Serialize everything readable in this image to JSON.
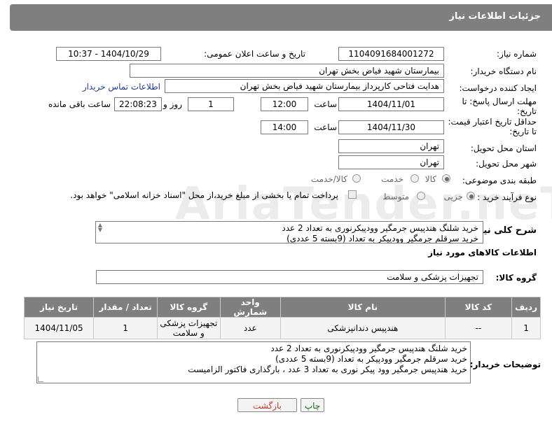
{
  "header": {
    "title": "جزئیات اطلاعات نیاز"
  },
  "fields": {
    "need_number_label": "شماره نیاز:",
    "need_number": "1104091684001272",
    "announce_label": "تاریخ و ساعت اعلان عمومی:",
    "announce_value": "1404/10/29 - 10:37",
    "buyer_org_label": "نام دستگاه خریدار:",
    "buyer_org": "بیمارستان شهید فیاض بخش تهران",
    "requester_label": "ایجاد کننده درخواست:",
    "requester": "هدایت فتاحی کارپرداز بیمارستان شهید فیاض بخش تهران",
    "contact_link": "اطلاعات تماس خریدار",
    "deadline_label_1": "مهلت ارسال پاسخ: تا",
    "deadline_label_2": "تاریخ:",
    "deadline_date": "1404/11/01",
    "time_label": "ساعت",
    "deadline_time": "12:00",
    "days_value": "1",
    "days_label": "روز و",
    "remaining_time": "22:08:23",
    "remaining_label": "ساعت باقی مانده",
    "min_price_label_1": "حداقل تاریخ اعتبار قیمت:",
    "min_price_label_2": "تا تاریخ:",
    "min_price_date": "1404/11/30",
    "min_price_time": "14:00",
    "province_label": "استان محل تحویل:",
    "province": "تهران",
    "city_label": "شهر محل تحویل:",
    "city": "تهران",
    "category_label": "طبقه بندی موضوعی:",
    "category_options": [
      "کالا",
      "خدمت",
      "کالا/خدمت"
    ],
    "process_label": "نوع فرآیند خرید :",
    "process_options": [
      "جزیی",
      "متوسط"
    ],
    "payment_note": "پرداخت تمام یا بخشی از مبلغ خرید،از محل \"اسناد خزانه اسلامی\" خواهد بود.",
    "description_label": "شرح کلی نیاز:",
    "description": "خرید شلنگ هندپیس جرمگیر وودپیکرنوری به تعداد 2 عدد\nخرید سرقلم جرمگیر وودپیکر به تعداد (9بسته 5 عددی)",
    "goods_info_title": "اطلاعات کالاهای مورد نیاز",
    "goods_group_label": "گروه کالا:",
    "goods_group": "تجهیزات پزشکی و سلامت"
  },
  "table": {
    "headers": [
      "ردیف",
      "کد کالا",
      "نام کالا",
      "واحد شمارش",
      "گروه کالا",
      "تعداد / مقدار",
      "تاریخ نیاز"
    ],
    "rows": [
      [
        "1",
        "--",
        "هندپیس دندانپزشکی",
        "عدد",
        "تجهیزات پزشکی و سلامت",
        "1",
        "1404/11/05"
      ]
    ]
  },
  "buyer_notes": {
    "label": "توضیحات خریدار:",
    "text": "خرید شلنگ هندپیس جرمگیر وودپیکرنوری به تعداد 2 عدد\nخرید سرقلم جرمگیر وودپیکر به تعداد (9بسته 5 عددی)\nخرید هندپیس جرمگیر وود پیکر نوری به تعداد 3 عدد ، بارگذاری فاکتور الزامیست"
  },
  "buttons": {
    "print": "چاپ",
    "back": "بازگشت"
  },
  "watermark": "AriaTender.neT",
  "colors": {
    "header_bg": "#7f7f7f",
    "link": "#1e3a8a",
    "back_text": "#c0392b",
    "print_text": "#1a6b1a"
  }
}
